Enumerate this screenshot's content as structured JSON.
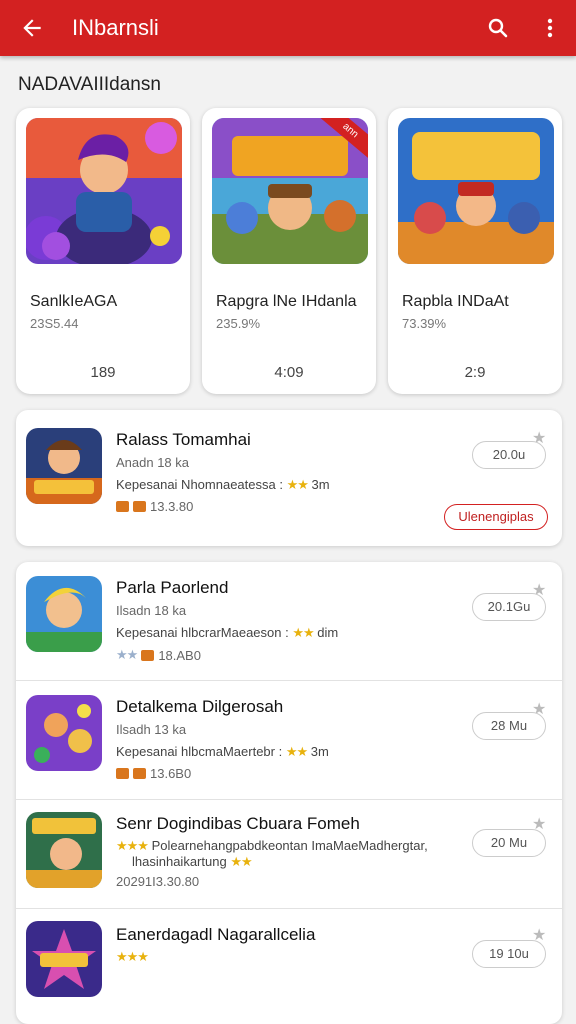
{
  "appbar": {
    "title": "INbarnsli",
    "back_icon": "arrow-back-icon",
    "search_icon": "search-icon",
    "menu_icon": "more-vert-icon",
    "color": "#d32121"
  },
  "section": {
    "title": "NADAVAIIIdansn"
  },
  "featured": [
    {
      "name": "SanlkIeAGA",
      "sub": "23S5.44",
      "count": "189"
    },
    {
      "name": "Rapgra lNe IHdanla",
      "sub": "235.9%",
      "count": "4:09",
      "badge": "ann"
    },
    {
      "name": "Rapbla INDaAt",
      "sub": "73.39%",
      "count": "2:9"
    }
  ],
  "list": [
    {
      "title": "Ralass Tomamhai",
      "sub": "Anadn 18 ka",
      "desc": "Kepesanai Nhomnaeatessa : ",
      "desc_tail": "3m",
      "meta": "13.3.80",
      "size": "20.0u",
      "install": "Ulenengiplas"
    },
    {
      "title": "Parla Paorlend",
      "sub": "Ilsadn 18 ka",
      "desc": "Kepesanai hlbcrarMaeaeson : ",
      "desc_tail": "dim",
      "meta": "18.AB0",
      "size": "20.1Gu"
    },
    {
      "title": "Detalkema Dilgerosah",
      "sub": "Ilsadh 13 ka",
      "desc": "Kepesanai hlbcmaMaertebr : ",
      "desc_tail": "3m",
      "meta": "13.6B0",
      "size": "28 Mu"
    },
    {
      "title": "Senr Dogindibas Cbuara Fomeh",
      "sub": "",
      "desc": "Polearnehangpabdkeontan ImaMaeMadhergtar,",
      "desc2": "lhasinhaikartung",
      "meta": "20291I3.30.80",
      "size": "20 Mu"
    },
    {
      "title": "Eanerdagadl Nagarallcelia",
      "sub": "",
      "desc": "",
      "meta": "",
      "size": "19 10u"
    }
  ]
}
